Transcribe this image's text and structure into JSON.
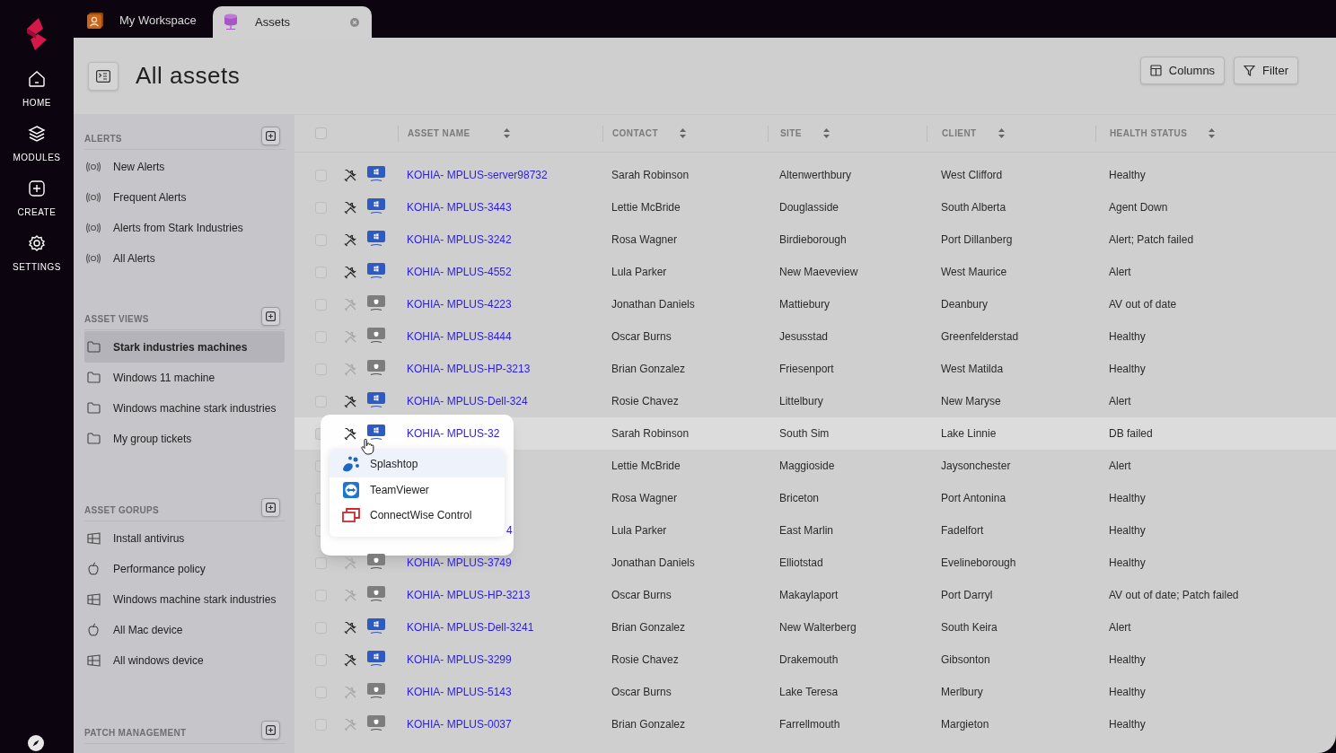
{
  "nav": {
    "items": [
      {
        "label": "HOME",
        "kind": "home"
      },
      {
        "label": "MODULES",
        "kind": "modules"
      },
      {
        "label": "CREATE",
        "kind": "create"
      },
      {
        "label": "SETTINGS",
        "kind": "settings"
      }
    ]
  },
  "tabs": [
    {
      "label": "My Workspace",
      "selected": false,
      "kind": "workspace"
    },
    {
      "label": "Assets",
      "selected": true,
      "kind": "assets"
    }
  ],
  "page": {
    "title": "All assets",
    "buttons": [
      {
        "label": "Columns",
        "kind": "columns"
      },
      {
        "label": "Filter",
        "kind": "filter"
      }
    ]
  },
  "sidebar": {
    "sections": [
      {
        "title": "ALERTS",
        "items": [
          {
            "label": "New Alerts",
            "kind": "alert",
            "selected": false
          },
          {
            "label": "Frequent Alerts",
            "kind": "alert",
            "selected": false
          },
          {
            "label": "Alerts from Stark Industries",
            "kind": "alert",
            "selected": false
          },
          {
            "label": "All Alerts",
            "kind": "alert",
            "selected": false
          }
        ]
      },
      {
        "title": "ASSET VIEWS",
        "items": [
          {
            "label": "Stark industries machines",
            "kind": "folder",
            "selected": true
          },
          {
            "label": "Windows 11 machine",
            "kind": "folder",
            "selected": false
          },
          {
            "label": "Windows machine stark industries",
            "kind": "folder",
            "selected": false
          },
          {
            "label": "My group tickets",
            "kind": "folder",
            "selected": false
          }
        ]
      },
      {
        "title": "ASSET GORUPS",
        "items": [
          {
            "label": "Install antivirus",
            "kind": "windows",
            "selected": false
          },
          {
            "label": "Performance policy",
            "kind": "mac",
            "selected": false
          },
          {
            "label": "Windows machine stark industries",
            "kind": "windows",
            "selected": false
          },
          {
            "label": "All Mac device",
            "kind": "mac",
            "selected": false
          },
          {
            "label": "All windows device",
            "kind": "windows",
            "selected": false
          }
        ]
      },
      {
        "title": "PATCH MANAGEMENT"
      }
    ]
  },
  "table": {
    "select_all_checked": false,
    "columns": [
      "ASSET NAME",
      "CONTACT",
      "SITE",
      "CLIENT",
      "HEALTH STATUS"
    ],
    "rows": [
      {
        "checked": false,
        "remote": true,
        "kind": "windows",
        "name": "KOHIA- MPLUS-server98732",
        "contact": "Sarah Robinson",
        "site": "Altenwerthbury",
        "client": "West Clifford",
        "health": "Healthy",
        "hovered": false
      },
      {
        "checked": false,
        "remote": true,
        "kind": "windows",
        "name": "KOHIA- MPLUS-3443",
        "contact": "Lettie McBride",
        "site": "Douglasside",
        "client": "South Alberta",
        "health": "Agent Down",
        "hovered": false
      },
      {
        "checked": false,
        "remote": true,
        "kind": "windows",
        "name": "KOHIA- MPLUS-3242",
        "contact": "Rosa Wagner",
        "site": "Birdieborough",
        "client": "Port Dillanberg",
        "health": "Alert; Patch failed",
        "hovered": false
      },
      {
        "checked": false,
        "remote": true,
        "kind": "windows",
        "name": "KOHIA- MPLUS-4552",
        "contact": "Lula Parker",
        "site": "New Maeveview",
        "client": "West Maurice",
        "health": "Alert",
        "hovered": false
      },
      {
        "checked": false,
        "remote": false,
        "kind": "mac",
        "name": "KOHIA- MPLUS-4223",
        "contact": "Jonathan Daniels",
        "site": "Mattiebury",
        "client": "Deanbury",
        "health": "AV out of date",
        "hovered": false
      },
      {
        "checked": false,
        "remote": false,
        "kind": "mac",
        "name": "KOHIA- MPLUS-8444",
        "contact": "Oscar Burns",
        "site": "Jesusstad",
        "client": "Greenfelderstad",
        "health": "Healthy",
        "hovered": false
      },
      {
        "checked": false,
        "remote": false,
        "kind": "mac",
        "name": "KOHIA- MPLUS-HP-3213",
        "contact": "Brian Gonzalez",
        "site": "Friesenport",
        "client": "West Matilda",
        "health": "Healthy",
        "hovered": false
      },
      {
        "checked": false,
        "remote": true,
        "kind": "windows",
        "name": "KOHIA- MPLUS-Dell-324",
        "contact": "Rosie Chavez",
        "site": "Littelbury",
        "client": "New Maryse",
        "health": "Alert",
        "hovered": false
      },
      {
        "checked": false,
        "remote": true,
        "kind": "windows",
        "name": "KOHIA- MPLUS-32",
        "contact": "Sarah Robinson",
        "site": "South Sim",
        "client": "Lake Linnie",
        "health": "DB failed",
        "hovered": true
      },
      {
        "checked": false,
        "contact": "Lettie McBride",
        "site": "Maggioside",
        "client": "Jaysonchester",
        "health": "Alert",
        "hovered": false
      },
      {
        "checked": false,
        "contact": "Rosa Wagner",
        "site": "Briceton",
        "client": "Port Antonina",
        "health": "Healthy",
        "hovered": false
      },
      {
        "checked": false,
        "name": "4",
        "name_cut": true,
        "contact": "Lula Parker",
        "site": "East Marlin",
        "client": "Fadelfort",
        "health": "Healthy",
        "hovered": false
      },
      {
        "checked": false,
        "remote": false,
        "kind": "mac",
        "name": "KOHIA- MPLUS-3749",
        "contact": "Jonathan Daniels",
        "site": "Elliotstad",
        "client": "Evelineborough",
        "health": "Healthy",
        "hovered": false
      },
      {
        "checked": false,
        "remote": false,
        "kind": "mac",
        "name": "KOHIA- MPLUS-HP-3213",
        "contact": "Oscar Burns",
        "site": "Makaylaport",
        "client": "Port Darryl",
        "health": "AV out of date; Patch failed",
        "hovered": false
      },
      {
        "checked": false,
        "remote": true,
        "kind": "windows",
        "name": "KOHIA- MPLUS-Dell-3241",
        "contact": "Brian Gonzalez",
        "site": "New Walterberg",
        "client": "South Keira",
        "health": "Alert",
        "hovered": false
      },
      {
        "checked": false,
        "remote": true,
        "kind": "windows",
        "name": "KOHIA- MPLUS-3299",
        "contact": "Rosie Chavez",
        "site": "Drakemouth",
        "client": "Gibsonton",
        "health": "Healthy",
        "hovered": false
      },
      {
        "checked": false,
        "remote": false,
        "kind": "mac",
        "name": "KOHIA- MPLUS-5143",
        "contact": "Oscar Burns",
        "site": "Lake Teresa",
        "client": "Merlbury",
        "health": "Healthy",
        "hovered": false
      },
      {
        "checked": false,
        "remote": false,
        "kind": "mac",
        "name": "KOHIA- MPLUS-0037",
        "contact": "Brian Gonzalez",
        "site": "Farrellmouth",
        "client": "Margieton",
        "health": "Healthy",
        "hovered": false
      }
    ]
  },
  "remote_menu": {
    "items": [
      {
        "label": "Splashtop",
        "kind": "splashtop",
        "selected": true
      },
      {
        "label": "TeamViewer",
        "kind": "teamviewer",
        "selected": false
      },
      {
        "label": "ConnectWise Control",
        "kind": "connectwise",
        "selected": false
      }
    ]
  }
}
